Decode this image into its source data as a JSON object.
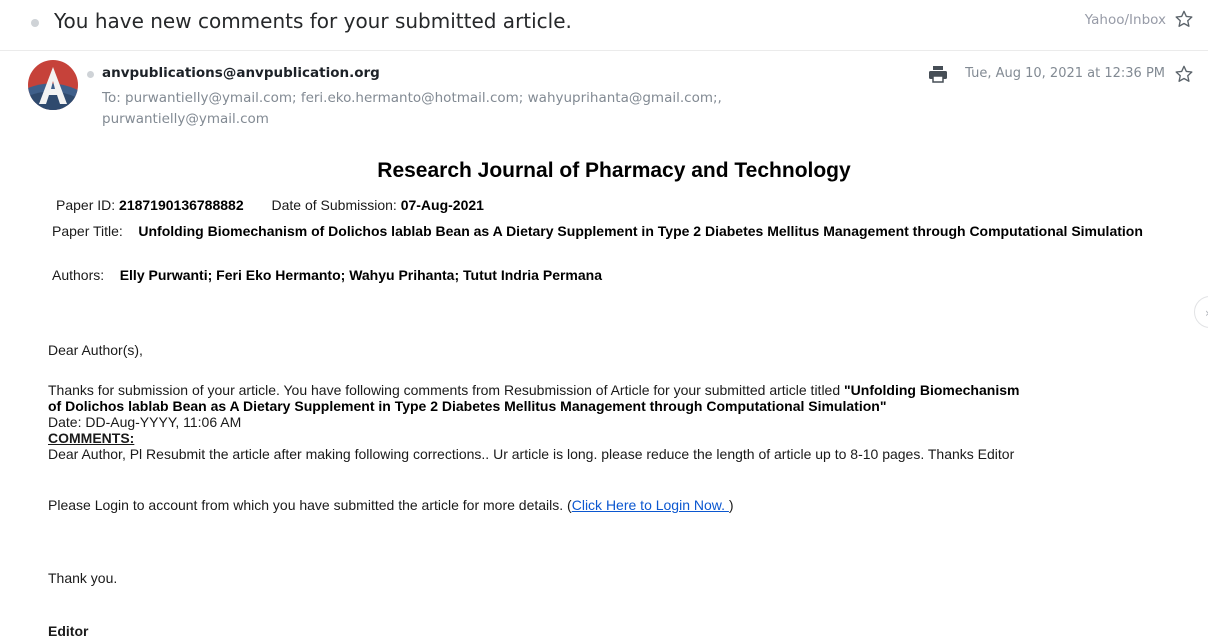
{
  "subject": {
    "text": "You have new comments for your submitted article.",
    "folder": "Yahoo/Inbox"
  },
  "message": {
    "sender": "anvpublications@anvpublication.org",
    "recipients_line1": "To: purwantielly@ymail.com; feri.eko.hermanto@hotmail.com; wahyuprihanta@gmail.com;,",
    "recipients_line2": "purwantielly@ymail.com",
    "date": "Tue, Aug 10, 2021 at 12:36 PM"
  },
  "body": {
    "journal_title": "Research Journal of Pharmacy and Technology",
    "paper_id_label": "Paper ID:",
    "paper_id": "2187190136788882",
    "submission_label": "Date of Submission:",
    "submission_date": "07-Aug-2021",
    "paper_title_label": "Paper Title:",
    "paper_title": "Unfolding Biomechanism of Dolichos lablab Bean as A Dietary Supplement in Type 2 Diabetes Mellitus Management through Computational Simulation",
    "authors_label": "Authors:",
    "authors": "Elly Purwanti; Feri Eko Hermanto; Wahyu Prihanta; Tutut Indria Permana",
    "greeting": "Dear Author(s),",
    "intro": "Thanks for submission of your article. You have following comments from Resubmission of Article for your submitted article titled ",
    "quoted_title_1": "\"Unfolding Biomechanism",
    "quoted_title_2": "of Dolichos lablab Bean as A Dietary Supplement in Type 2 Diabetes Mellitus Management through Computational Simulation\"",
    "comment_date": "Date: DD-Aug-YYYY, 11:06 AM",
    "comments_label": "COMMENTS:",
    "comment_text": "Dear Author, Pl Resubmit the article after making following corrections.. Ur article is long. please reduce the length of article up to 8-10 pages. Thanks Editor",
    "login_text": "Please Login to account from which you have submitted the article for more details. (",
    "login_link": "Click Here to Login Now. ",
    "login_close": ")",
    "thanks": "Thank you.",
    "signoff": "Editor"
  },
  "icons": {
    "star": "star-outline-icon",
    "print": "printer-icon",
    "avatar": "sender-avatar",
    "next": "chevron-right-icon"
  },
  "colors": {
    "link": "#0b57d0",
    "avatar_red": "#c6423a",
    "avatar_blue": "#3f5f8a"
  }
}
